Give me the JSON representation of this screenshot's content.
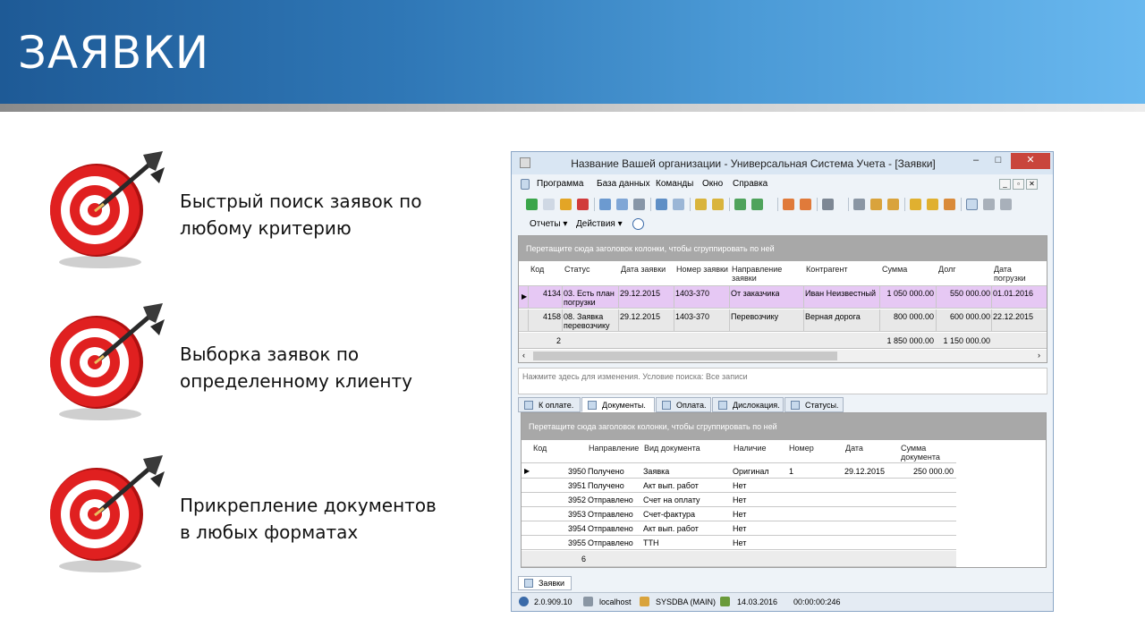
{
  "slide": {
    "title": "ЗАЯВКИ",
    "features": [
      {
        "line1": "Быстрый поиск заявок по",
        "line2": "любому критерию"
      },
      {
        "line1": "Выборка заявок по",
        "line2": "определенному клиенту"
      },
      {
        "line1": "Прикрепление документов",
        "line2": "в любых форматах"
      }
    ]
  },
  "window": {
    "title": "Название Вашей организации - Универсальная Система Учета - [Заявки]",
    "minimize": "–",
    "maximize": "□",
    "close": "✕",
    "menu": [
      "Программа",
      "База данных",
      "Команды",
      "Окно",
      "Справка"
    ],
    "toolbar2": {
      "reports": "Отчеты ▾",
      "actions": "Действия ▾"
    },
    "orders_grid": {
      "group_hint": "Перетащите сюда заголовок колонки, чтобы сгруппировать по ней",
      "columns": [
        "Код",
        "Статус",
        "Дата заявки",
        "Номер заявки",
        "Направление заявки",
        "Контрагент",
        "Сумма",
        "Долг",
        "Дата погрузки"
      ],
      "rows": [
        {
          "code": "4134",
          "status": "03. Есть план погрузки",
          "date": "29.12.2015",
          "number": "1403-370",
          "direction": "От заказчика",
          "counterparty": "Иван Неизвестный",
          "sum": "1 050 000.00",
          "debt": "550 000.00",
          "load_date": "01.01.2016"
        },
        {
          "code": "4158",
          "status": "08. Заявка перевозчику",
          "date": "29.12.2015",
          "number": "1403-370",
          "direction": "Перевозчику",
          "counterparty": "Верная дорога",
          "sum": "800 000.00",
          "debt": "600 000.00",
          "load_date": "22.12.2015"
        }
      ],
      "footer": {
        "count": "2",
        "sum_total": "1 850 000.00",
        "debt_total": "1 150 000.00"
      }
    },
    "filter_text": "Нажмите здесь для изменения. Условие поиска: Все записи",
    "tabs": [
      "К оплате.",
      "Документы.",
      "Оплата.",
      "Дислокация.",
      "Статусы."
    ],
    "docs_grid": {
      "group_hint": "Перетащите сюда заголовок колонки, чтобы сгруппировать по ней",
      "columns": [
        "Код",
        "Направление",
        "Вид документа",
        "Наличие",
        "Номер",
        "Дата",
        "Сумма документа"
      ],
      "rows": [
        {
          "code": "3950",
          "direction": "Получено",
          "doc_type": "Заявка",
          "presence": "Оригинал",
          "number": "1",
          "date": "29.12.2015",
          "amount": "250 000.00"
        },
        {
          "code": "3951",
          "direction": "Получено",
          "doc_type": "Акт вып. работ",
          "presence": "Нет",
          "number": "",
          "date": "",
          "amount": ""
        },
        {
          "code": "3952",
          "direction": "Отправлено",
          "doc_type": "Счет на оплату",
          "presence": "Нет",
          "number": "",
          "date": "",
          "amount": ""
        },
        {
          "code": "3953",
          "direction": "Отправлено",
          "doc_type": "Счет-фактура",
          "presence": "Нет",
          "number": "",
          "date": "",
          "amount": ""
        },
        {
          "code": "3954",
          "direction": "Отправлено",
          "doc_type": "Акт вып. работ",
          "presence": "Нет",
          "number": "",
          "date": "",
          "amount": ""
        },
        {
          "code": "3955",
          "direction": "Отправлено",
          "doc_type": "ТТН",
          "presence": "Нет",
          "number": "",
          "date": "",
          "amount": ""
        }
      ],
      "footer_count": "6"
    },
    "bottom_tab": "Заявки",
    "status": {
      "version": "2.0.909.10",
      "host": "localhost",
      "user": "SYSDBA (MAIN)",
      "date": "14.03.2016",
      "timer": "00:00:00:246"
    }
  }
}
